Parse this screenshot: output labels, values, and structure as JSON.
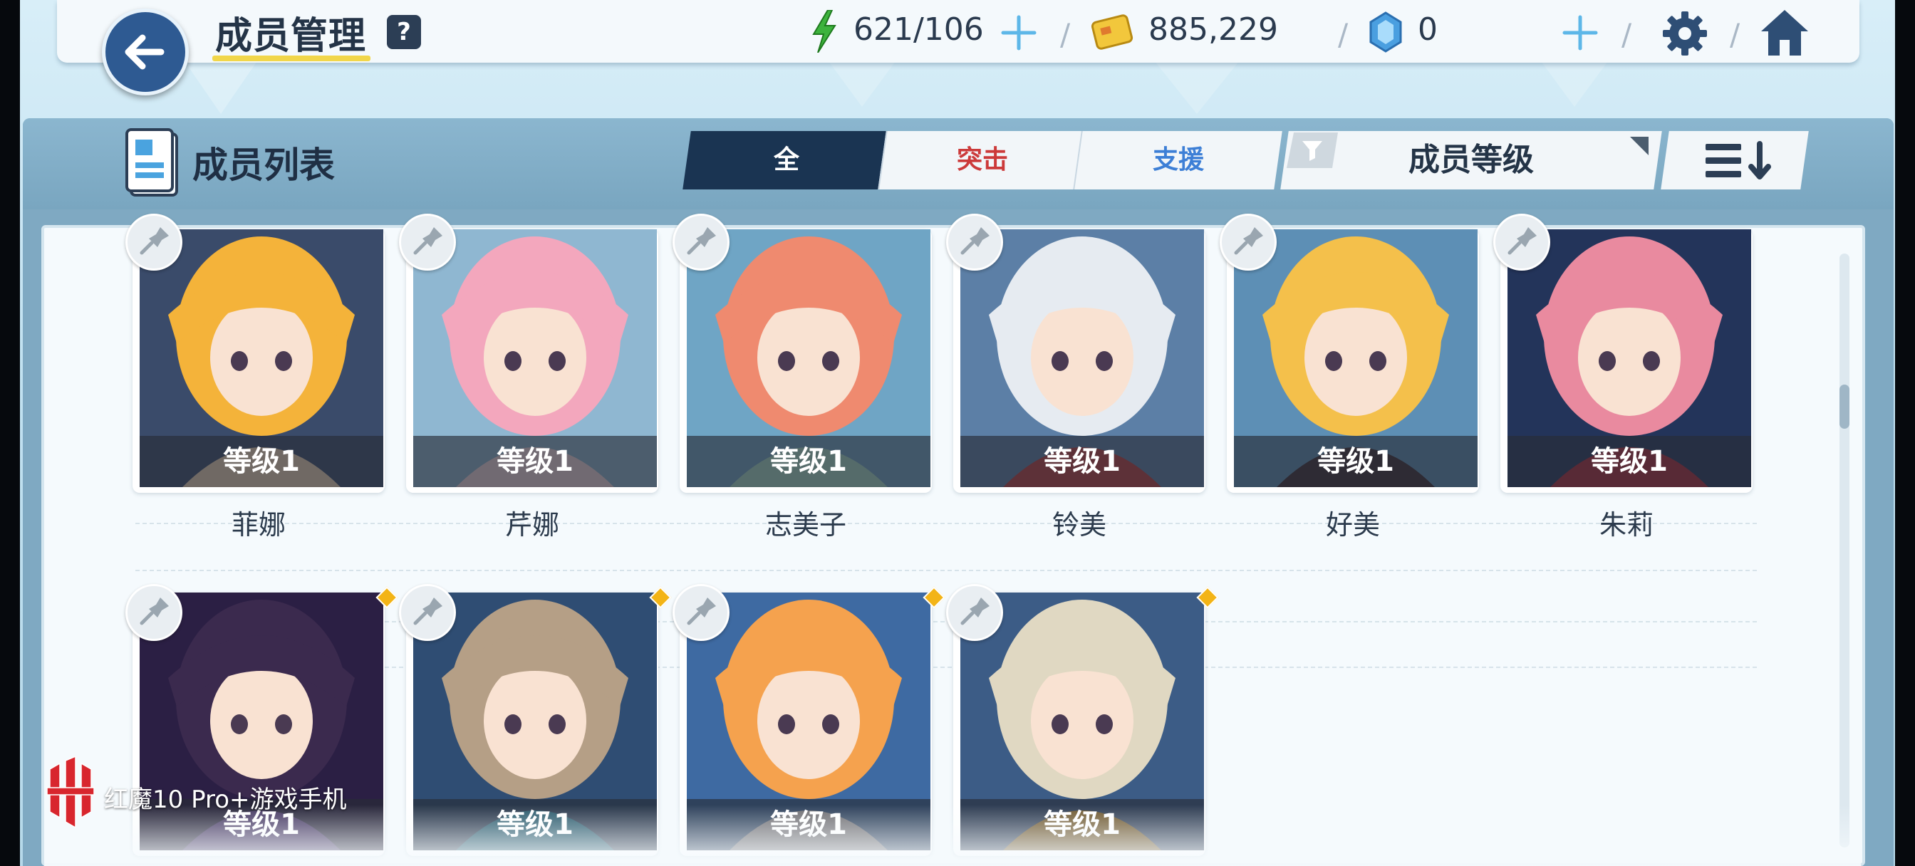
{
  "header": {
    "title": "成员管理",
    "help_label": "?",
    "energy": "621/106",
    "credits": "885,229",
    "gems": "0",
    "separator": "/"
  },
  "list": {
    "title": "成员列表",
    "tabs": [
      {
        "label": "全",
        "active": true
      },
      {
        "label": "突击",
        "active": false
      },
      {
        "label": "支援",
        "active": false
      }
    ],
    "sort_label": "成员等级"
  },
  "members": [
    {
      "name": "菲娜",
      "level": "等级1",
      "palette": [
        "#3a4b6a",
        "#f4b33a",
        "#f7d9b8"
      ]
    },
    {
      "name": "芹娜",
      "level": "等级1",
      "palette": [
        "#8fb7d1",
        "#f3a7bd",
        "#f8dde0"
      ]
    },
    {
      "name": "志美子",
      "level": "等级1",
      "palette": [
        "#6fa5c5",
        "#ef8a6f",
        "#a8e0c8"
      ]
    },
    {
      "name": "铃美",
      "level": "等级1",
      "palette": [
        "#5c7fa6",
        "#e6ebf1",
        "#c03a3a"
      ]
    },
    {
      "name": "好美",
      "level": "等级1",
      "palette": [
        "#5d8fb5",
        "#f4c04b",
        "#3a2a2e"
      ]
    },
    {
      "name": "朱莉",
      "level": "等级1",
      "palette": [
        "#23345a",
        "#e98a9f",
        "#b32634"
      ]
    },
    {
      "name": "",
      "level": "等级1",
      "palette": [
        "#2b1f44",
        "#3b2a4e",
        "#7b4bb0"
      ]
    },
    {
      "name": "",
      "level": "等级1",
      "palette": [
        "#2f4d73",
        "#b59f86",
        "#29a9c8"
      ]
    },
    {
      "name": "",
      "level": "等级1",
      "palette": [
        "#3e6aa2",
        "#f5a24e",
        "#f2e7de"
      ]
    },
    {
      "name": "",
      "level": "等级1",
      "palette": [
        "#3c5c86",
        "#e0d8c2",
        "#f1a51e"
      ]
    }
  ],
  "watermark": {
    "text": "红魔10 Pro+游戏手机"
  },
  "colors": {
    "accent_dark": "#1a3452",
    "striker_red": "#cc3a3a",
    "special_blue": "#3d7fd6",
    "energy_green": "#3db33d",
    "new_dot": "#f3b416"
  }
}
